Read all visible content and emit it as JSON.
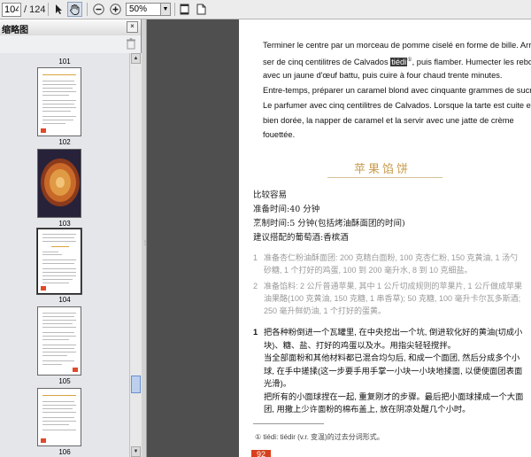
{
  "toolbar": {
    "page_current": "104",
    "page_total": "/ 124",
    "zoom": "50%",
    "tools": {
      "select": "cursor-icon",
      "hand": "hand-icon",
      "zoom_out": "zoom-out-icon",
      "zoom_in": "zoom-in-icon",
      "fit_page": "fit-page-icon",
      "fit_width": "fit-width-icon"
    }
  },
  "sidebar": {
    "title": "缩略图",
    "close": "×",
    "pages": [
      {
        "label": "101"
      },
      {
        "label": "102"
      },
      {
        "label": "103"
      },
      {
        "label": "104"
      },
      {
        "label": "105"
      },
      {
        "label": "106"
      }
    ]
  },
  "document": {
    "french": [
      "Terminer le centre par un morceau de pomme ciselé en forme de bille. Arro-",
      "ser de cinq centilitres de Calvados ",
      "avec un jaune d'œuf battu, puis cuire à four chaud trente minutes.",
      "Entre-temps, préparer un caramel blond avec cinquante grammes de sucre.",
      "Le parfumer avec cinq centilitres de Calvados. Lorsque la tarte est cuite et",
      "bien dorée, la napper de caramel et la servir avec une jatte de crème",
      "fouettée."
    ],
    "french_tail": ", puis flamber. Humecter les rebords",
    "highlight_word": "tiédi",
    "footnote_mark": "①",
    "recipe_title": "苹果馅饼",
    "meta": [
      "比较容易",
      "准备时间:40 分钟",
      "烹制时间:5 分钟(包括烤油酥面团的时间)",
      "建议搭配的葡萄酒:香槟酒"
    ],
    "ingredients": [
      {
        "num": "1",
        "lines": [
          "准备杏仁粉油酥面团: 200 克精白面粉, 100 克杏仁粉, 150 克黄油, 1 汤勺",
          "砂糖, 1 个打好的鸡蛋, 100 到 200 毫升水, 8 到 10 克细盐。"
        ]
      },
      {
        "num": "2",
        "lines": [
          "准备馅料: 2 公斤普通苹果, 其中 1 公斤切成规则的苹果片, 1 公斤做成苹果",
          "油果酪(100 克黄油, 150 克糖, 1 串香草); 50 克糖, 100 毫升卡尔瓦多斯酒;",
          "250 毫升鲜奶油, 1 个打好的蛋黄。"
        ]
      }
    ],
    "steps": [
      {
        "num": "1",
        "lines": [
          "把各种粉倒进一个瓦罐里, 在中央挖出一个坑, 倒进软化好的黄油(切成小",
          "块)、糖、盐、打好的鸡蛋以及水。用指尖轻轻搅拌。",
          "当全部面粉和其他材料都已混合均匀后, 和成一个面团, 然后分成多个小",
          "球, 在手中搓揉(这一步要手用手掌一小块一小块地揉面, 以便使面团表面",
          "光滑)。",
          "把所有的小面球捏在一起, 重复刚才的步骤。最后把小面球揉成一个大面",
          "团, 用撒上少许面粉的棉布盖上, 放在阴凉处醒几个小时。"
        ]
      }
    ],
    "footnote": "① tiédi: tiédir (v.r. 变温)的过去分词形式。",
    "page_number": "92"
  }
}
